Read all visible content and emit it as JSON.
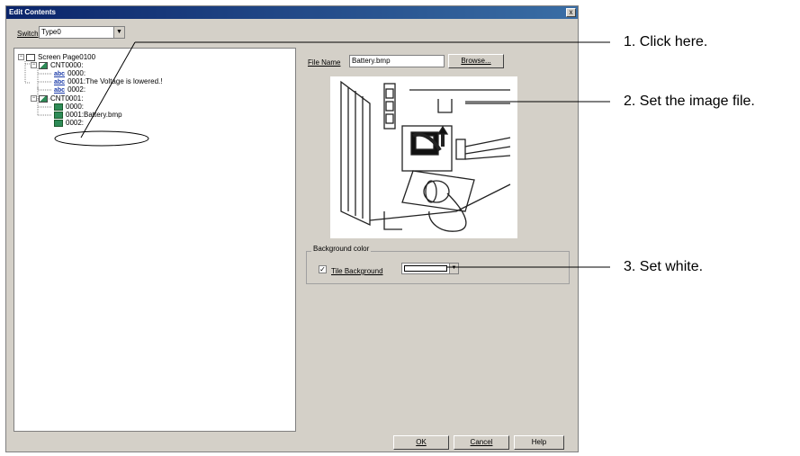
{
  "dialog": {
    "title": "Edit Contents",
    "close_label": "x",
    "switch_label": "Switch",
    "switch_value": "Type0",
    "select_arrow": "▼"
  },
  "tree": {
    "root": "Screen Page0100",
    "items": [
      {
        "label": "CNT0000:",
        "icon": "content-icon"
      },
      {
        "label": "0000:",
        "icon": "text-icon"
      },
      {
        "label": "0001:The Voltage is lowered.!",
        "icon": "text-icon"
      },
      {
        "label": "0002:",
        "icon": "text-icon"
      },
      {
        "label": "CNT0001:",
        "icon": "content-icon"
      },
      {
        "label": "0000:",
        "icon": "image-icon"
      },
      {
        "label": "0001:Battery.bmp",
        "icon": "image-icon"
      },
      {
        "label": "0002:",
        "icon": "image-icon"
      }
    ],
    "abc": "abc",
    "expand_glyph": "−"
  },
  "file": {
    "label": "File Name",
    "value": "Battery.bmp",
    "browse": "Browse..."
  },
  "background": {
    "group_title": "Background color",
    "checkbox_label": "Tile Background",
    "checked_glyph": "✓",
    "color": "#ffffff",
    "arrow": "▼"
  },
  "buttons": {
    "ok": "OK",
    "cancel": "Cancel",
    "help": "Help"
  },
  "callouts": {
    "c1": "1. Click here.",
    "c2": "2. Set the image file.",
    "c3": "3. Set white."
  },
  "colors": {
    "dialog_face": "#d4d0c8",
    "title_start": "#0a246a",
    "title_end": "#3a6ea5",
    "image_icon": "#2e8b57",
    "text_icon": "#1a3aa8"
  }
}
